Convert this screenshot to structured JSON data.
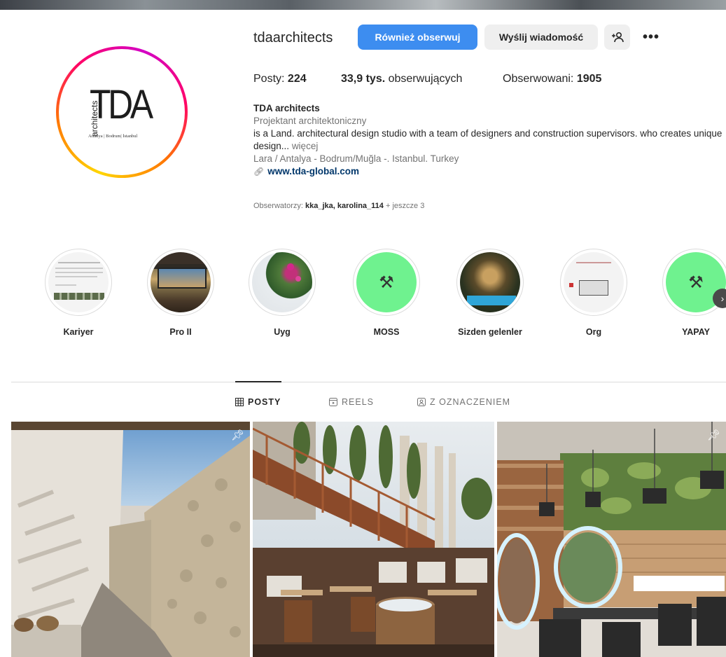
{
  "profile": {
    "username": "tdaarchitects",
    "follow_label": "Również obserwuj",
    "message_label": "Wyślij wiadomość",
    "add_user_icon": "add-user-icon",
    "more_icon": "more-options-icon",
    "avatar_logo": {
      "side_text": "architects",
      "main_text": "TDA",
      "sub_text": "Antalya | Bodrum| İstanbul"
    }
  },
  "stats": {
    "posts_label": "Posty:",
    "posts_value": "224",
    "followers_value": "33,9 tys.",
    "followers_label": "obserwujących",
    "following_label": "Obserwowani:",
    "following_value": "1905"
  },
  "bio": {
    "name": "TDA architects",
    "category": "Projektant architektoniczny",
    "text": "is a Land. architectural design studio with a team of designers and construction supervisors. who creates unique design...",
    "more": "więcej",
    "location": "Lara / Antalya - Bodrum/Muğla -. Istanbul. Turkey",
    "link_icon": "link-icon",
    "link": "www.tda-global.com"
  },
  "followed_by": {
    "prefix": "Obserwatorzy:",
    "users": "kka_jka, karolina_114",
    "suffix": "+ jeszcze 3"
  },
  "highlights": [
    {
      "label": "Kariyer"
    },
    {
      "label": "Pro II"
    },
    {
      "label": "Uyg"
    },
    {
      "label": "MOSS"
    },
    {
      "label": "Sizden gelenler"
    },
    {
      "label": "Org"
    },
    {
      "label": "YAPAY"
    }
  ],
  "tabs": [
    {
      "label": "POSTY",
      "icon": "grid-icon",
      "active": true
    },
    {
      "label": "REELS",
      "icon": "reels-icon",
      "active": false
    },
    {
      "label": "Z OZNACZENIEM",
      "icon": "tagged-icon",
      "active": false
    }
  ],
  "colors": {
    "follow_button": "#3d8df0",
    "secondary_button": "#efefef",
    "link": "#00376b",
    "highlight_green": "#6ff28f"
  }
}
